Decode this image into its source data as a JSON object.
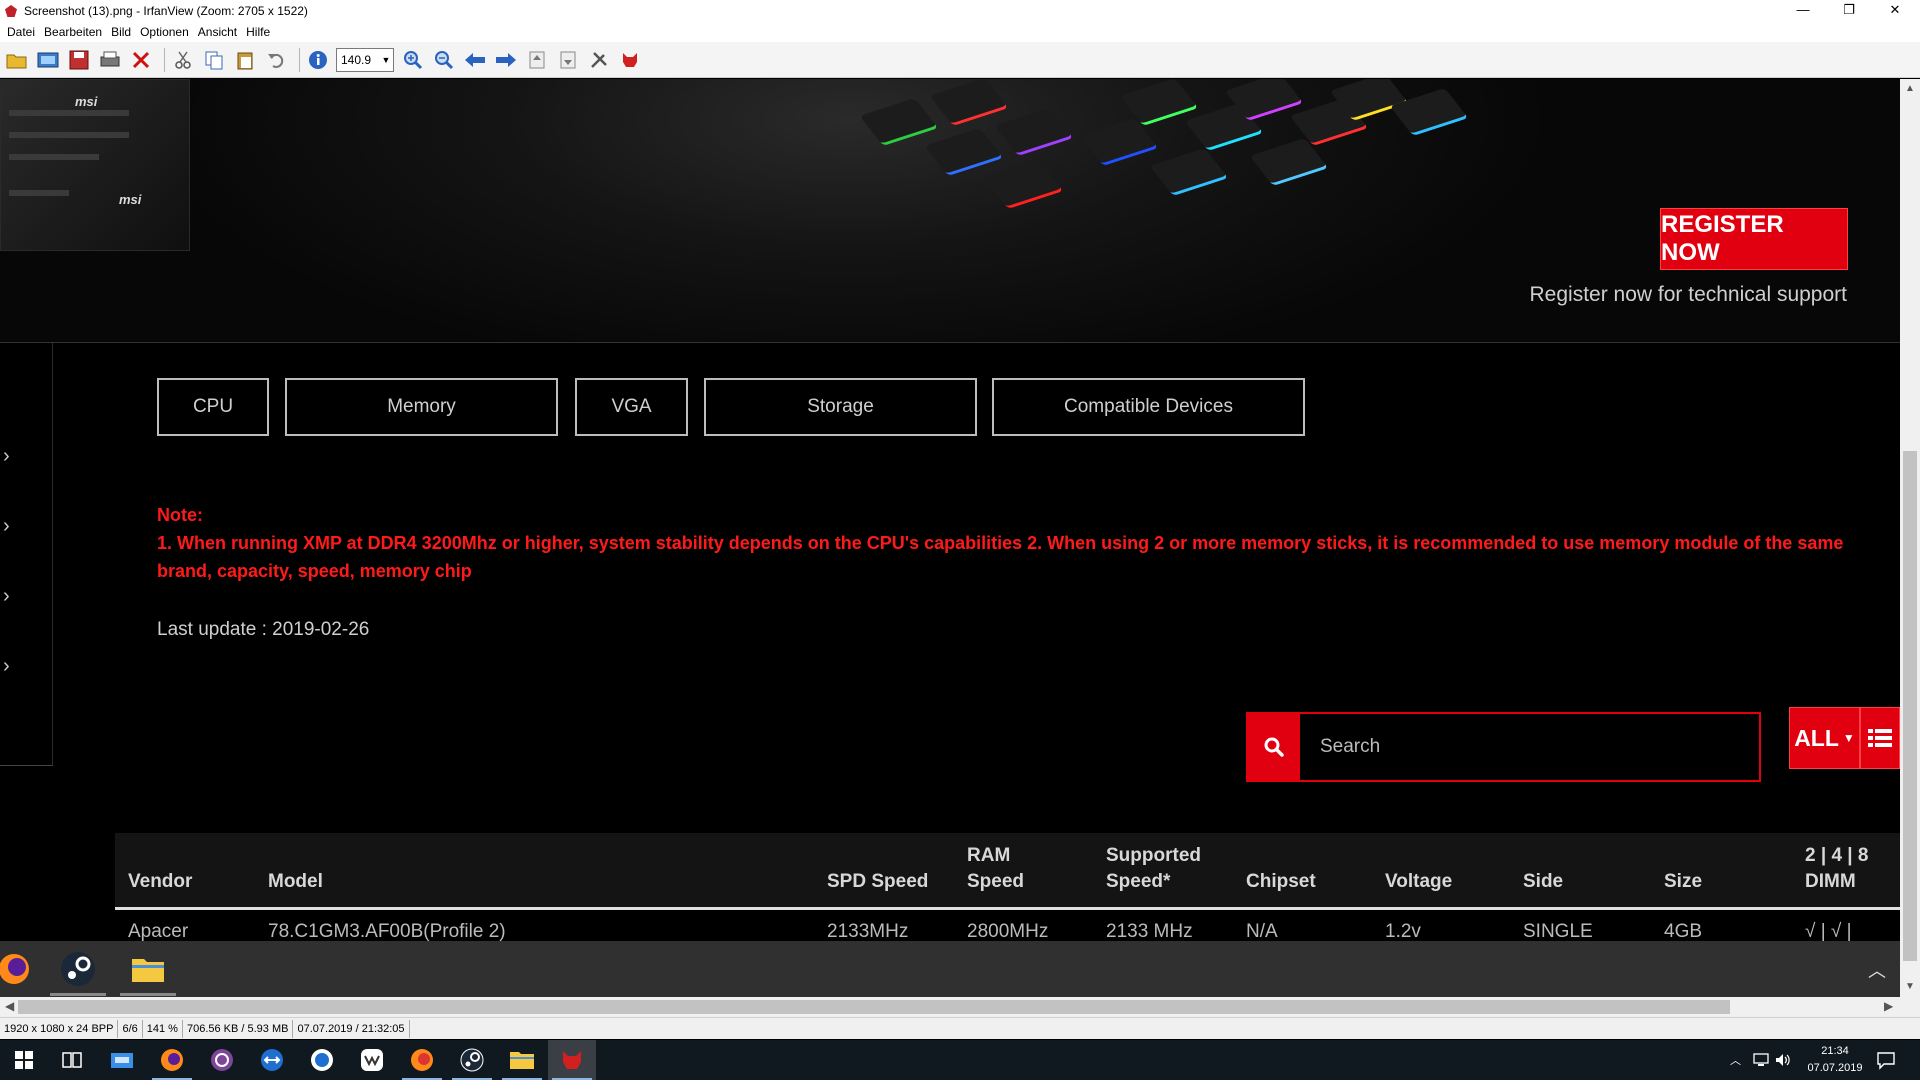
{
  "window": {
    "title": "Screenshot (13).png - IrfanView (Zoom: 2705 x 1522)",
    "minimize": "—",
    "maximize": "❐",
    "close": "✕"
  },
  "menu": [
    "Datei",
    "Bearbeiten",
    "Bild",
    "Optionen",
    "Ansicht",
    "Hilfe"
  ],
  "toolbar": {
    "zoom_value": "140.9"
  },
  "banner": {
    "register_label": "REGISTER NOW",
    "register_sub": "Register now for technical support",
    "mobo_brand": "msi"
  },
  "tabs": [
    {
      "label": "CPU"
    },
    {
      "label": "Memory"
    },
    {
      "label": "VGA"
    },
    {
      "label": "Storage"
    },
    {
      "label": "Compatible Devices"
    }
  ],
  "note": {
    "title": "Note:",
    "body": "1. When running XMP at DDR4 3200Mhz or higher, system stability depends on the CPU's capabilities 2. When using 2 or more memory sticks, it is recommended to use memory module of the same brand, capacity, speed, memory chip"
  },
  "last_update": "Last update : 2019-02-26",
  "search": {
    "placeholder": "Search",
    "filter_label": "ALL"
  },
  "table": {
    "headers": [
      "Vendor",
      "Model",
      "SPD Speed",
      "RAM\nSpeed",
      "Supported\nSpeed*",
      "Chipset",
      "Voltage",
      "Side",
      "Size",
      "2 | 4 | 8\nDIMM"
    ],
    "rows": [
      [
        "Apacer",
        "78.C1GM3.AF00B(Profile 2)",
        "2133MHz",
        "2800MHz",
        "2133 MHz",
        "N/A",
        "1.2v",
        "SINGLE",
        "4GB",
        "√ | √ |"
      ]
    ]
  },
  "statusbar": [
    "1920 x 1080 x 24 BPP",
    "6/6",
    "141 %",
    "706.56 KB / 5.93 MB",
    "07.07.2019 / 21:32:05"
  ],
  "clock": {
    "time": "21:34",
    "date": "07.07.2019"
  },
  "colors": {
    "accent": "#e00010",
    "note": "#ff1a1a"
  }
}
